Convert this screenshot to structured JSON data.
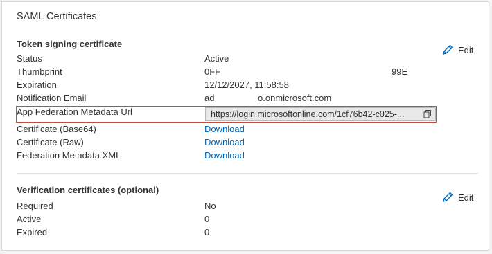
{
  "card": {
    "title": "SAML Certificates"
  },
  "token_signing": {
    "title": "Token signing certificate",
    "edit_label": "Edit",
    "rows": [
      {
        "label": "Status",
        "value": "Active"
      },
      {
        "label": "Thumbprint",
        "value_left": "0FF",
        "value_right": "99E"
      },
      {
        "label": "Expiration",
        "value": "12/12/2027, 11:58:58"
      },
      {
        "label": "Notification Email",
        "value_left": "ad",
        "value_right": "o.onmicrosoft.com"
      },
      {
        "label": "App Federation Metadata Url",
        "value": "https://login.microsoftonline.com/1cf76b42-c025-..."
      },
      {
        "label": "Certificate (Base64)",
        "value": "Download"
      },
      {
        "label": "Certificate (Raw)",
        "value": "Download"
      },
      {
        "label": "Federation Metadata XML",
        "value": "Download"
      }
    ]
  },
  "verification": {
    "title": "Verification certificates (optional)",
    "edit_label": "Edit",
    "rows": [
      {
        "label": "Required",
        "value": "No"
      },
      {
        "label": "Active",
        "value": "0"
      },
      {
        "label": "Expired",
        "value": "0"
      }
    ]
  },
  "icons": {
    "edit": "pencil-icon",
    "copy": "copy-icon"
  },
  "colors": {
    "link": "#0067b8",
    "highlight": "#c74a3a"
  }
}
